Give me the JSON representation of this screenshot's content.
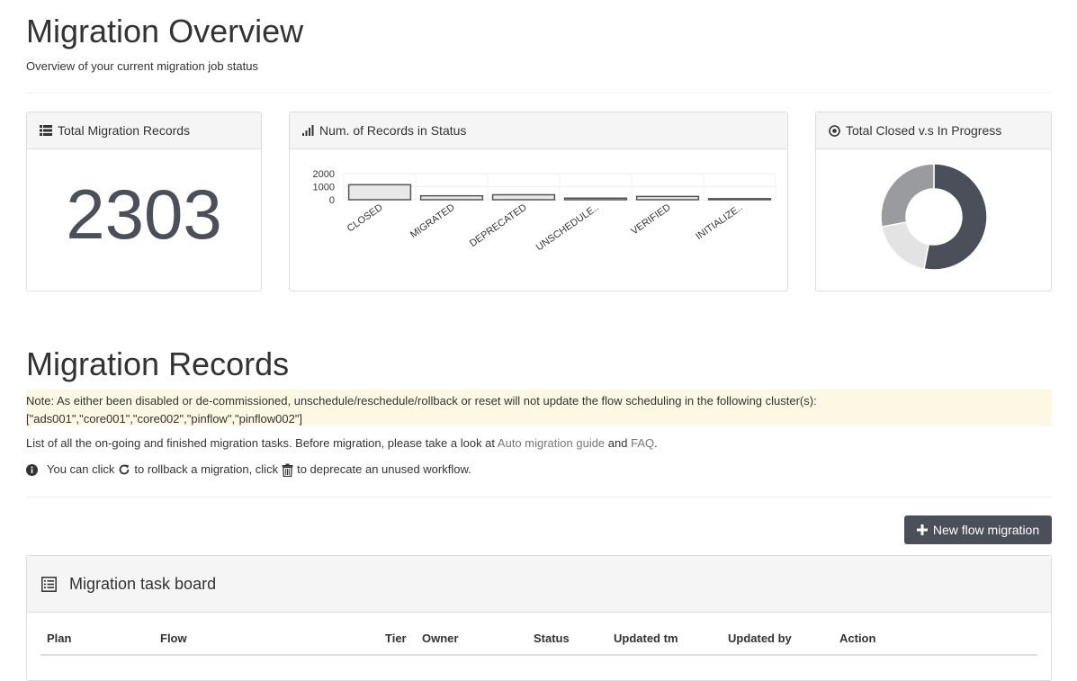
{
  "header": {
    "title": "Migration Overview",
    "subtitle": "Overview of your current migration job status"
  },
  "cards": {
    "total": {
      "title": "Total Migration Records",
      "value": "2303",
      "icon": "list-icon"
    },
    "status": {
      "title": "Num. of Records in Status",
      "icon": "signal-icon"
    },
    "donut": {
      "title": "Total Closed v.s In Progress",
      "icon": "dot-circle-icon"
    }
  },
  "chart_data": [
    {
      "type": "bar",
      "categories": [
        "CLOSED",
        "MIGRATED",
        "DEPRECATED",
        "UNSCHEDULE..",
        "VERIFIED",
        "INITIALIZE.."
      ],
      "values": [
        1150,
        300,
        380,
        120,
        250,
        80
      ],
      "ylim": [
        0,
        2000
      ],
      "yticks": [
        0,
        1000,
        2000
      ],
      "grid": true,
      "colors": {
        "fill": "#e8e8e8",
        "stroke": "#555555"
      }
    },
    {
      "type": "pie",
      "values": [
        53,
        19,
        28
      ],
      "colors": [
        "#4b4f5a",
        "#e3e3e3",
        "#9a9b9e"
      ]
    }
  ],
  "records": {
    "title": "Migration Records",
    "note_line1": "Note: As either been disabled or de-commissioned, unschedule/reschedule/rollback or reset will not update the flow scheduling in the following cluster(s):",
    "note_line2": "[\"ads001\",\"core001\",\"core002\",\"pinflow\",\"pinflow002\"]",
    "info_prefix": "List of all the on-going and finished migration tasks. Before migration, please take a look at ",
    "guide_link": "Auto migration guide",
    "info_and": " and ",
    "faq_link": "FAQ",
    "info_suffix": ".",
    "hint_a": "You can click",
    "hint_b": "to rollback a migration, click",
    "hint_c": "to deprecate an unused workflow.",
    "new_button": "New flow migration"
  },
  "board": {
    "title": "Migration task board",
    "columns": [
      "Plan",
      "Flow",
      "Tier",
      "Owner",
      "Status",
      "Updated tm",
      "Updated by",
      "Action"
    ]
  }
}
